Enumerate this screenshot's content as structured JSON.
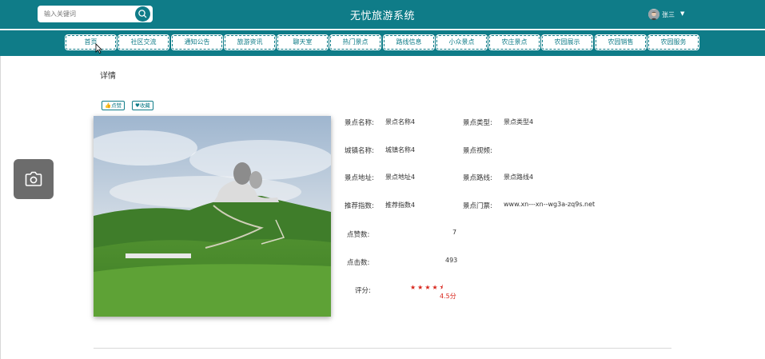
{
  "header": {
    "title": "无忧旅游系统",
    "search_placeholder": "输入关键词",
    "username": "张三",
    "bg_color": "#0f7c88"
  },
  "nav": {
    "items": [
      "首页",
      "社区交流",
      "通知公告",
      "旅游资讯",
      "聊天室",
      "热门景点",
      "路线信息",
      "小众景点",
      "农庄景点",
      "农园展示",
      "农园销售",
      "农园服务"
    ]
  },
  "page": {
    "heading": "详情",
    "like_label": "点赞",
    "favorite_label": "收藏"
  },
  "details": {
    "name_label": "景点名称:",
    "name_value": "景点名称4",
    "type_label": "景点类型:",
    "type_value": "景点类型4",
    "city_label": "城镇名称:",
    "city_value": "城镇名称4",
    "video_label": "景点视频:",
    "address_label": "景点地址:",
    "address_value": "景点地址4",
    "route_label": "景点路线:",
    "route_value": "景点路线4",
    "recommend_label": "推荐指数:",
    "recommend_value": "推荐指数4",
    "ticket_label": "景点门票:",
    "ticket_value": "www.xn---xn--wg3a-zq9s.net",
    "likes_label": "点赞数:",
    "likes_value": "7",
    "clicks_label": "点击数:",
    "clicks_value": "493",
    "rating_label": "评分:",
    "rating_text": "4.5分",
    "rating_value": 4.5
  }
}
